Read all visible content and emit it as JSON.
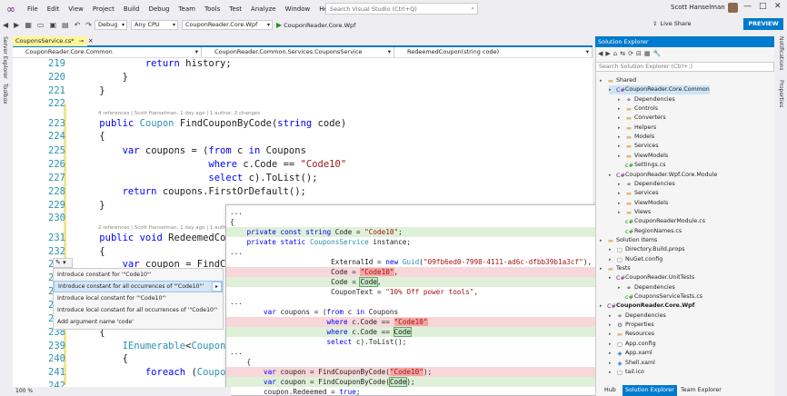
{
  "menubar": {
    "items": [
      "File",
      "Edit",
      "View",
      "Project",
      "Build",
      "Debug",
      "Team",
      "Tools",
      "Test",
      "Analyze",
      "Window",
      "Help"
    ],
    "search_placeholder": "Search Visual Studio (Ctrl+Q)",
    "user": "Scott Hanselman"
  },
  "toolbar": {
    "config": "Debug",
    "platform": "Any CPU",
    "project": "CouponReader.Core.Wpf",
    "run_target": "CouponReader.Core.Wpf",
    "liveshare": "Live Share",
    "preview_badge": "PREVIEW"
  },
  "left_rail": [
    "Server Explorer",
    "Toolbox"
  ],
  "right_rail": [
    "Notifications",
    "Properties"
  ],
  "editor": {
    "tab": "CouponsService.cs*",
    "nav": [
      "CouponReader.Core.Common",
      "CouponReader.Common.Services.CouponsService",
      "RedeemedCoupon(string code)"
    ],
    "zoom": "100 %",
    "lens1": "4 references | Scott Hanselman, 1 day ago | 1 author, 2 changes",
    "lens2": "2 references | Scott Hanselman, 1 day ago | 1 author, 1 change",
    "line_numbers": [
      "219",
      "220",
      "221",
      "222",
      "223",
      "224",
      "225",
      "226",
      "227",
      "228",
      "229",
      "230",
      "231",
      "232",
      "233",
      "234",
      "235",
      "236",
      "237",
      "238",
      "239",
      "240",
      "241",
      "242"
    ]
  },
  "quick_actions": {
    "items": [
      "Introduce constant for '\"Code10\"'",
      "Introduce constant for all occurrences of '\"Code10\"'",
      "Introduce local constant for '\"Code10\"'",
      "Introduce local constant for all occurrences of '\"Code10\"'",
      "Add argument name 'code'"
    ]
  },
  "solution_explorer": {
    "title": "Solution Explorer",
    "search_placeholder": "Search Solution Explorer (Ctrl+;)",
    "nodes": [
      {
        "label": "Shared",
        "level": 0,
        "icon": "folder"
      },
      {
        "label": "CouponReader.Core.Common",
        "level": 1,
        "icon": "csproj",
        "selected": true
      },
      {
        "label": "Dependencies",
        "level": 2,
        "icon": "deps"
      },
      {
        "label": "Controls",
        "level": 2,
        "icon": "folder"
      },
      {
        "label": "Converters",
        "level": 2,
        "icon": "folder"
      },
      {
        "label": "Helpers",
        "level": 2,
        "icon": "folder"
      },
      {
        "label": "Models",
        "level": 2,
        "icon": "folder"
      },
      {
        "label": "Services",
        "level": 2,
        "icon": "folder"
      },
      {
        "label": "ViewModels",
        "level": 2,
        "icon": "folder"
      },
      {
        "label": "Settings.cs",
        "level": 2,
        "icon": "cs"
      },
      {
        "label": "CouponReader.Wpf.Core.Module",
        "level": 1,
        "icon": "csproj"
      },
      {
        "label": "Dependencies",
        "level": 2,
        "icon": "deps"
      },
      {
        "label": "Services",
        "level": 2,
        "icon": "folder"
      },
      {
        "label": "ViewModels",
        "level": 2,
        "icon": "folder"
      },
      {
        "label": "Views",
        "level": 2,
        "icon": "folder"
      },
      {
        "label": "CouponReaderModule.cs",
        "level": 2,
        "icon": "cs"
      },
      {
        "label": "RegionNames.cs",
        "level": 2,
        "icon": "cs"
      },
      {
        "label": "Solution Items",
        "level": 0,
        "icon": "folder"
      },
      {
        "label": "Directory.Build.props",
        "level": 1,
        "icon": "file"
      },
      {
        "label": "NuGet.config",
        "level": 1,
        "icon": "file"
      },
      {
        "label": "Tests",
        "level": 0,
        "icon": "folder"
      },
      {
        "label": "CouponReader.UnitTests",
        "level": 1,
        "icon": "csproj"
      },
      {
        "label": "Dependencies",
        "level": 2,
        "icon": "deps"
      },
      {
        "label": "CouponsServiceTests.cs",
        "level": 2,
        "icon": "cs"
      },
      {
        "label": "CouponReader.Core.Wpf",
        "level": 0,
        "icon": "csproj",
        "bold": true
      },
      {
        "label": "Dependencies",
        "level": 1,
        "icon": "deps"
      },
      {
        "label": "Properties",
        "level": 1,
        "icon": "wrench"
      },
      {
        "label": "Resources",
        "level": 1,
        "icon": "folder"
      },
      {
        "label": "App.config",
        "level": 1,
        "icon": "file"
      },
      {
        "label": "App.xaml",
        "level": 1,
        "icon": "xaml"
      },
      {
        "label": "Shell.xaml",
        "level": 1,
        "icon": "xaml"
      },
      {
        "label": "tail.ico",
        "level": 1,
        "icon": "file"
      }
    ],
    "tabs": [
      "Hub",
      "Solution Explorer",
      "Team Explorer"
    ]
  },
  "colors": {
    "accent": "#007acc",
    "added": "#dff0d8",
    "removed": "#f8d7da"
  }
}
